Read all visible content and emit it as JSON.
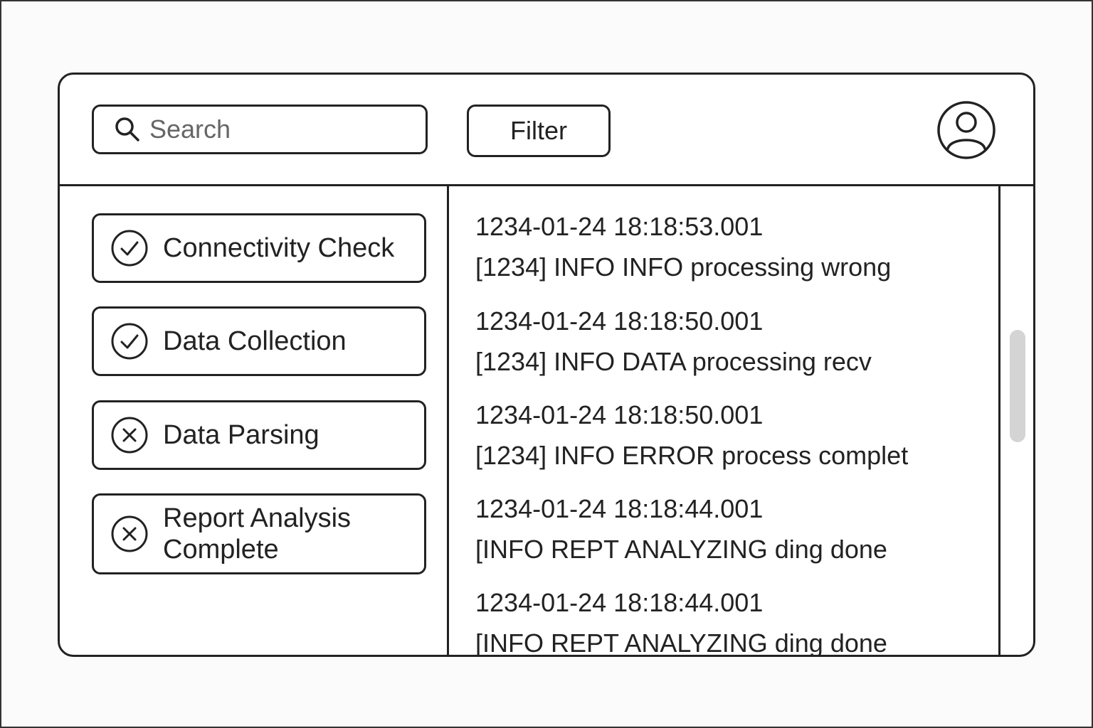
{
  "header": {
    "search": {
      "placeholder": "Search",
      "value": ""
    },
    "filter_label": "Filter",
    "avatar_icon": "user-icon"
  },
  "steps": [
    {
      "label": "Connectivity Check",
      "status": "success",
      "icon": "check-circle-icon"
    },
    {
      "label": "Data Collection",
      "status": "success",
      "icon": "check-circle-icon"
    },
    {
      "label": "Data Parsing",
      "status": "failed",
      "icon": "x-circle-icon"
    },
    {
      "label": "Report Analysis Complete",
      "status": "failed",
      "icon": "x-circle-icon"
    }
  ],
  "logs": [
    {
      "timestamp": "1234-01-24 18:18:53.001",
      "message": "[1234]  INFO  INFO processing wrong"
    },
    {
      "timestamp": "1234-01-24 18:18:50.001",
      "message": "[1234]  INFO  DATA processing recv"
    },
    {
      "timestamp": "1234-01-24 18:18:50.001",
      "message": "[1234]  INFO  ERROR process complet"
    },
    {
      "timestamp": "1234-01-24 18:18:44.001",
      "message": "[INFO  REPT  ANALYZING ding done"
    },
    {
      "timestamp": "1234-01-24 18:18:44.001",
      "message": "[INFO  REPT  ANALYZING ding done"
    }
  ],
  "colors": {
    "border": "#222222",
    "scroll_thumb": "#d4d4d4",
    "background": "#ffffff"
  }
}
